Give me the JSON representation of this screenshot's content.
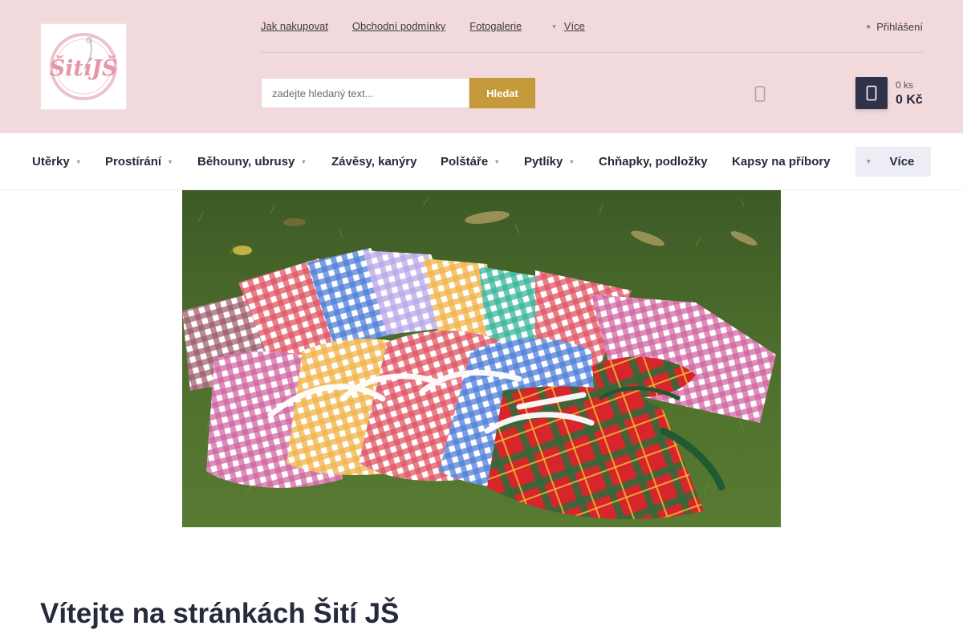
{
  "logo": {
    "text": "ŠitíJŠ",
    "color": "#e8a0b0"
  },
  "top_nav": {
    "links": [
      "Jak nakupovat",
      "Obchodní podmínky",
      "Fotogalerie"
    ],
    "more_label": "Více",
    "more_icon": "chevron-down-icon"
  },
  "login": {
    "label": "Přihlášení",
    "icon": "user-icon"
  },
  "search": {
    "placeholder": "zadejte hledaný text...",
    "button_label": "Hledat",
    "button_color": "#c49a3a"
  },
  "favorites": {
    "icon": "heart-icon"
  },
  "cart": {
    "count": "0 ks",
    "price": "0 Kč",
    "icon": "cart-icon",
    "button_color": "#30324a"
  },
  "main_nav": {
    "items": [
      {
        "label": "Utěrky",
        "has_dropdown": true
      },
      {
        "label": "Prostírání",
        "has_dropdown": true
      },
      {
        "label": "Běhouny, ubrusy",
        "has_dropdown": true
      },
      {
        "label": "Závěsy, kanýry",
        "has_dropdown": false
      },
      {
        "label": "Polštáře",
        "has_dropdown": true
      },
      {
        "label": "Pytlíky",
        "has_dropdown": true
      },
      {
        "label": "Chňapky, podložky",
        "has_dropdown": false
      },
      {
        "label": "Kapsy na příbory",
        "has_dropdown": false
      }
    ],
    "more_label": "Více",
    "more_icon": "menu-icon"
  },
  "hero": {
    "image": "checkered-fabric-bags-on-grass"
  },
  "welcome": {
    "heading": "Vítejte na stránkách Šití JŠ"
  },
  "colors": {
    "header_bg": "#f2d9dc",
    "text_dark": "#262a3a",
    "accent": "#c49a3a"
  }
}
